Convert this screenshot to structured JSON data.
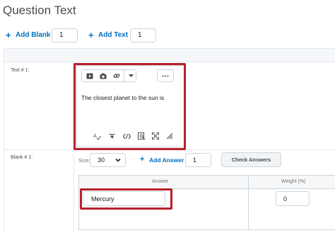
{
  "header": {
    "title": "Question Text"
  },
  "toolbar": {
    "add_blank_label": "Add Blank",
    "add_blank_count": "1",
    "add_text_label": "Add Text",
    "add_text_count": "1"
  },
  "text_section": {
    "label": "Text # 1:",
    "editor_text": "The closest planet to the sun is",
    "toolbar_icons": [
      "video-icon",
      "camera-icon",
      "link-icon",
      "dropdown-chevron-icon",
      "more-options-icon"
    ],
    "format_icons": [
      "spell-check-icon",
      "accessibility-icon",
      "code-icon",
      "preview-icon",
      "fullscreen-icon",
      "resize-icon"
    ]
  },
  "blank_section": {
    "label": "Blank # 1:",
    "size_label": "Size:",
    "size_value": "30",
    "add_answer_label": "Add Answer",
    "add_answer_count": "1",
    "check_answers_label": "Check Answers",
    "table": {
      "answer_header": "Answer",
      "weight_header": "Weight (%)",
      "rows": [
        {
          "answer": "Mercury",
          "weight": "0"
        }
      ]
    }
  },
  "colors": {
    "link": "#006fbf",
    "highlight": "#b8202b",
    "border": "#cdd5dc"
  }
}
